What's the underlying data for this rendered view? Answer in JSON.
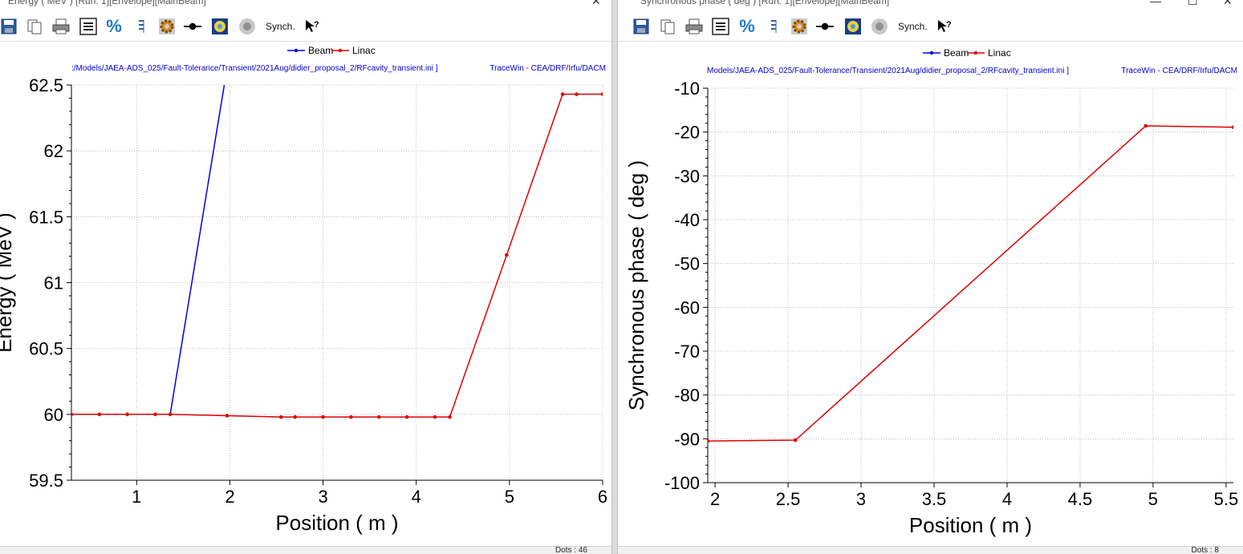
{
  "left_window": {
    "title": "Energy ( MeV ) [Run: 1][Envelope][MainBeam]",
    "path_text": ":/Models/JAEA-ADS_025/Fault-Tolerance/Transient/2021Aug/didier_proposal_2/RFcavity_transient.ini ]",
    "credit_text": "TraceWin - CEA/DRF/Irfu/DACM",
    "status_text": "Dots : 46"
  },
  "right_window": {
    "title": "Synchronous phase ( deg ) [Run: 1][Envelope][MainBeam]",
    "path_text": "Models/JAEA-ADS_025/Fault-Tolerance/Transient/2021Aug/didier_proposal_2/RFcavity_transient.ini ]",
    "credit_text": "TraceWin - CEA/DRF/Irfu/DACM",
    "status_text": "Dots : 8"
  },
  "toolbar": {
    "synch_label": "Synch.",
    "icons": [
      "save-icon",
      "copy-icon",
      "print-icon",
      "list-icon",
      "percent-icon",
      "bars-icon",
      "gear-icon",
      "line-marker-icon",
      "palette-icon",
      "record-icon",
      "help-cursor-icon"
    ]
  },
  "colors": {
    "beam": "#0000dd",
    "linac": "#dd0000",
    "path_text": "#0000cc",
    "grid": "#b0b0b0"
  },
  "chart_data": [
    {
      "type": "line",
      "xlabel": "Position ( m )",
      "ylabel": "Energy ( MeV )",
      "xlim": [
        0.3,
        6.0
      ],
      "ylim": [
        59.5,
        62.5
      ],
      "xticks": [
        1,
        2,
        3,
        4,
        5,
        6
      ],
      "yticks": [
        59.5,
        60,
        60.5,
        61,
        61.5,
        62,
        62.5
      ],
      "grid": true,
      "legend_position": "top-center",
      "series": [
        {
          "name": "Beam",
          "color": "#0000dd",
          "markers": false,
          "x": [
            1.36,
            1.94
          ],
          "y": [
            60.0,
            62.5
          ]
        },
        {
          "name": "Linac",
          "color": "#dd0000",
          "markers": true,
          "x": [
            0.3,
            0.6,
            0.9,
            1.2,
            1.36,
            1.97,
            2.55,
            2.7,
            3.0,
            3.3,
            3.6,
            3.9,
            4.2,
            4.36,
            4.97,
            5.57,
            5.72,
            6.0
          ],
          "y": [
            60.0,
            60.0,
            60.0,
            60.0,
            60.0,
            59.99,
            59.98,
            59.98,
            59.98,
            59.98,
            59.98,
            59.98,
            59.98,
            59.98,
            61.21,
            62.43,
            62.43,
            62.43
          ]
        }
      ]
    },
    {
      "type": "line",
      "xlabel": "Position ( m )",
      "ylabel": "Synchronous phase ( deg )",
      "xlim": [
        1.95,
        5.55
      ],
      "ylim": [
        -100,
        -10
      ],
      "xticks": [
        2,
        2.5,
        3,
        3.5,
        4,
        4.5,
        5,
        5.5
      ],
      "yticks": [
        -100,
        -90,
        -80,
        -70,
        -60,
        -50,
        -40,
        -30,
        -20,
        -10
      ],
      "grid": true,
      "legend_position": "top-center",
      "series": [
        {
          "name": "Beam",
          "color": "#0000dd",
          "markers": false,
          "x": [],
          "y": []
        },
        {
          "name": "Linac",
          "color": "#dd0000",
          "markers": true,
          "x": [
            1.95,
            2.55,
            4.95,
            5.55
          ],
          "y": [
            -90.5,
            -90.3,
            -18.6,
            -18.9
          ]
        }
      ]
    }
  ]
}
